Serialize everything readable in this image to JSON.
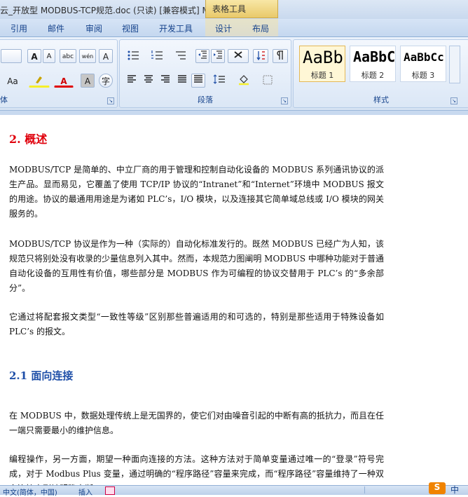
{
  "window": {
    "title": "云_开放型 MODBUS-TCP规范.doc (只读) [兼容模式] M",
    "context_tab_title": "表格工具"
  },
  "ribbon_tabs": [
    "引用",
    "邮件",
    "审阅",
    "视图",
    "开发工具",
    "设计",
    "布局"
  ],
  "font_group": {
    "label": "体",
    "buttons": [
      "A",
      "A",
      "abc",
      "wén",
      "A",
      "Aa",
      "A",
      "A",
      "字"
    ]
  },
  "paragraph_group": {
    "label": "段落"
  },
  "styles_group": {
    "label": "样式",
    "styles": [
      {
        "sample": "AaBb",
        "name": "标题 1"
      },
      {
        "sample": "AaBbC",
        "name": "标题 2"
      },
      {
        "sample": "AaBbCc",
        "name": "标题 3"
      }
    ]
  },
  "document": {
    "heading_overview": "2. 概述",
    "para1": "MODBUS/TCP 是简单的、中立厂商的用于管理和控制自动化设备的 MODBUS 系列通讯协议的派生产品。显而易见，它覆盖了使用 TCP/IP 协议的“Intranet”和“Internet”环境中 MODBUS 报文的用途。协议的最通用用途是为诸如 PLC’s，I/O 模块，以及连接其它简单域总线或 I/O 模块的网关服务的。",
    "para2": "MODBUS/TCP 协议是作为一种（实际的）自动化标准发行的。既然 MODBUS 已经广为人知，该规范只将别处没有收录的少量信息列入其中。然而，本规范力图阐明 MODBUS 中哪种功能对于普通自动化设备的互用性有价值，哪些部分是 MODBUS 作为可编程的协议交替用于 PLC’s 的“多余部分”。",
    "para3": "它通过将配套报文类型“一致性等级”区别那些普遍适用的和可选的，特别是那些适用于特殊设备如 PLC’s 的报文。",
    "heading_2_1": "2.1 面向连接",
    "para4": "在 MODBUS 中，数据处理传统上是无国界的，使它们对由噪音引起的中断有高的抵抗力，而且在任一端只需要最小的维护信息。",
    "para5": "编程操作，另一方面，期望一种面向连接的方法。这种方法对于简单变量通过唯一的“登录”符号完成，对于 Modbus Plus 变量，通过明确的“程序路径”容量来完成，而“程序路径”容量维持了一种双向连接直到被明确中断。"
  },
  "statusbar": {
    "language": "中文(简体，中国)",
    "insert_mode": "插入",
    "ime": "中"
  }
}
